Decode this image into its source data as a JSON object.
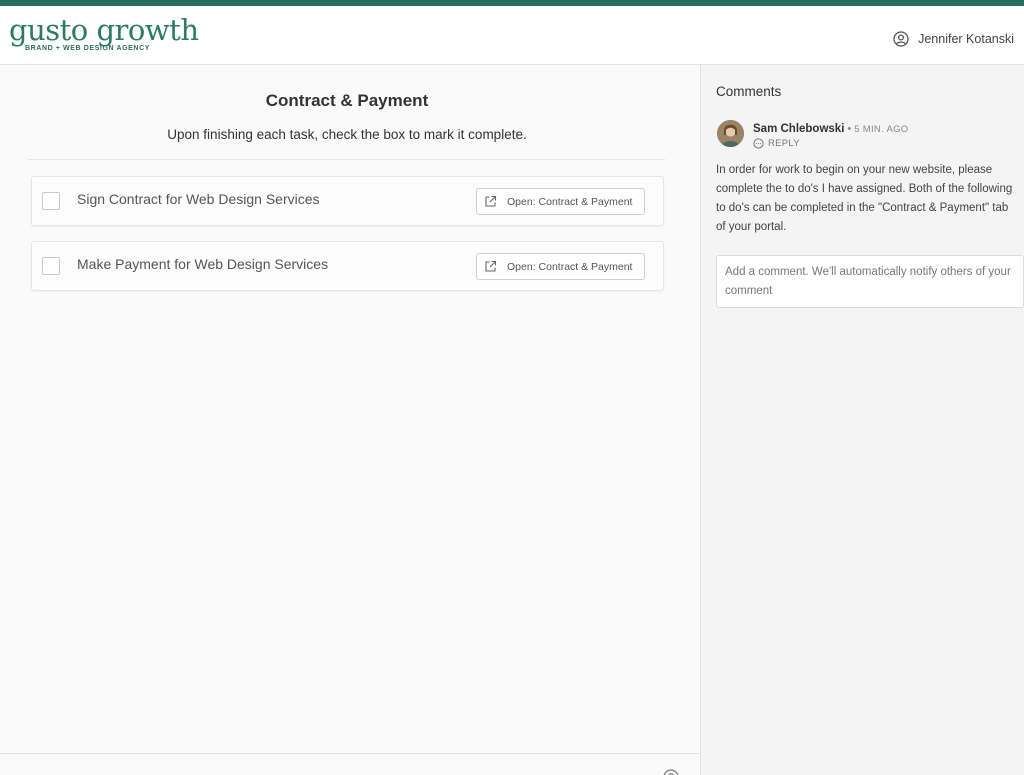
{
  "brand": {
    "name": "gusto growth",
    "tagline": "BRAND + WEB DESIGN AGENCY",
    "accent_color": "#2b7a63",
    "top_bar_color": "#2b6e5c"
  },
  "header": {
    "user_icon": "user-circle-icon",
    "user_name": "Jennifer Kotanski"
  },
  "main": {
    "title": "Contract & Payment",
    "subtitle": "Upon finishing each task, check the box to mark it complete.",
    "tasks": [
      {
        "label": "Sign Contract for Web Design Services",
        "checked": false,
        "button_label": "Open: Contract & Payment",
        "button_icon": "external-link-icon"
      },
      {
        "label": "Make Payment for Web Design Services",
        "checked": false,
        "button_label": "Open: Contract & Payment",
        "button_icon": "external-link-icon"
      }
    ],
    "help_icon": "help-circle-icon"
  },
  "comments": {
    "title": "Comments",
    "items": [
      {
        "author": "Sam Chlebowski",
        "separator": "•",
        "time": "5 MIN. AGO",
        "reply_label": "REPLY",
        "text": "In order for work to begin on your new website, please complete the to do's I have assigned. Both of the following to do's can be completed in the \"Contract & Payment\" tab of your portal."
      }
    ],
    "input_placeholder": "Add a comment.  We'll automatically notify others of your comment"
  }
}
